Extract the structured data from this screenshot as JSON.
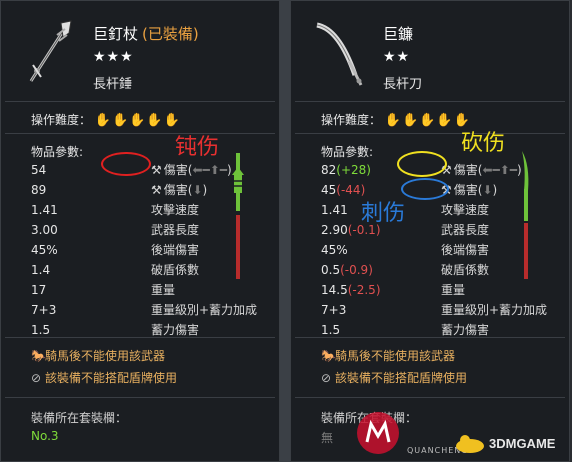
{
  "left": {
    "name": "巨釘杖",
    "equipped": "(已裝備)",
    "stars": "★★★",
    "type": "長杆錘",
    "difficulty_label": "操作難度：",
    "difficulty_hands": "✋✋✋✋✋",
    "params_title": "物品參數:",
    "stats": [
      {
        "v": "54",
        "d": "",
        "label": "傷害(",
        "arrows": "⬅━⬆━",
        "end": ")"
      },
      {
        "v": "89",
        "d": "",
        "label": "傷害(",
        "arrows": "⬇",
        "end": ")"
      },
      {
        "v": "1.41",
        "d": "",
        "label": "攻擊速度"
      },
      {
        "v": "3.00",
        "d": "",
        "label": "武器長度"
      },
      {
        "v": "45%",
        "d": "",
        "label": "後端傷害"
      },
      {
        "v": "1.4",
        "d": "",
        "label": "破盾係數"
      },
      {
        "v": "17",
        "d": "",
        "label": "重量"
      },
      {
        "v": "7+3",
        "d": "",
        "label": "重量級別+蓄力加成"
      },
      {
        "v": "1.5",
        "d": "",
        "label": "蓄力傷害"
      }
    ],
    "warn1": "騎馬後不能使用該武器",
    "warn2": "該裝備不能搭配盾牌使用",
    "set_title": "裝備所在套裝欄：",
    "set_value": "No.3",
    "annotation": "钝伤",
    "bar_level": 0.45
  },
  "right": {
    "name": "巨鐮",
    "stars": "★★",
    "type": "長杆刀",
    "difficulty_label": "操作難度：",
    "difficulty_hands": "✋✋✋✋✋",
    "params_title": "物品參數:",
    "stats": [
      {
        "v": "82",
        "d": "(+28)",
        "dc": "green",
        "label": "傷害(",
        "arrows": "⬅━⬆━",
        "end": ")"
      },
      {
        "v": "45",
        "d": "(-44)",
        "dc": "red",
        "label": "傷害(",
        "arrows": "⬇",
        "end": ")"
      },
      {
        "v": "1.41",
        "d": "",
        "label": "攻擊速度"
      },
      {
        "v": "2.90",
        "d": "(-0.1)",
        "dc": "red",
        "label": "武器長度"
      },
      {
        "v": "45%",
        "d": "",
        "label": "後端傷害"
      },
      {
        "v": "0.5",
        "d": "(-0.9)",
        "dc": "red",
        "label": "破盾係數"
      },
      {
        "v": "14.5",
        "d": "(-2.5)",
        "dc": "red",
        "label": "重量"
      },
      {
        "v": "7+3",
        "d": "",
        "label": "重量級別+蓄力加成"
      },
      {
        "v": "1.5",
        "d": "",
        "label": "蓄力傷害"
      }
    ],
    "warn1": "騎馬後不能使用該武器",
    "warn2": "該裝備不能搭配盾牌使用",
    "set_title": "裝備所在套裝欄：",
    "set_value": "無",
    "annotation1": "砍伤",
    "annotation2": "刺伤",
    "bar_level": 0.55
  },
  "watermark": {
    "brand": "3DMGAME",
    "sub": "QUANCHENG"
  },
  "colors": {
    "green": "#7fdc3a",
    "red": "#e05050",
    "gold": "#e8a040"
  }
}
